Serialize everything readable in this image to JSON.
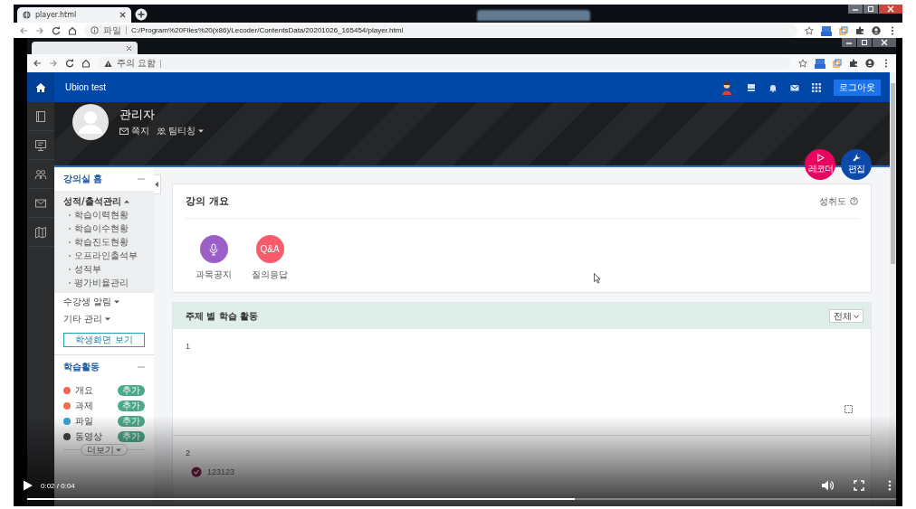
{
  "outer_browser": {
    "tab": {
      "title": "player.html"
    },
    "address": {
      "scheme_label": "파일",
      "url": "C:/Program%20Files%20(x86)/Lecoder/ContentsData/20201026_165454/player.html"
    }
  },
  "inner_browser": {
    "address": {
      "security_label": "주의 요함"
    }
  },
  "site": {
    "name": "Ubion test",
    "logout": "로그아웃"
  },
  "profile": {
    "name": "관리자",
    "links": [
      {
        "label": "쪽지",
        "kind": "mail"
      },
      {
        "label": "팀티칭",
        "kind": "team"
      }
    ]
  },
  "fabs": [
    {
      "label": "레코더",
      "kind": "play",
      "color": "#e8055f"
    },
    {
      "label": "편집",
      "kind": "wrench",
      "color": "#0b4aa8"
    }
  ],
  "course_menu": {
    "title": "강의실 홈",
    "groups": [
      {
        "label": "성적/출석관리",
        "expanded": true,
        "children": [
          "학습이력현황",
          "학습이수현황",
          "학습진도현황",
          "오프라인출석부",
          "성적부",
          "평가비율관리"
        ]
      },
      {
        "label": "수강생 알림",
        "expanded": false
      },
      {
        "label": "기타 관리",
        "expanded": false
      }
    ],
    "button": "학생화면 보기"
  },
  "activities": {
    "title": "학습활동",
    "items": [
      {
        "label": "개요",
        "color": "#f0645a",
        "action": "추가"
      },
      {
        "label": "과제",
        "color": "#f2704e",
        "action": "추가"
      },
      {
        "label": "파일",
        "color": "#3aa0d8",
        "action": "추가"
      },
      {
        "label": "동영상",
        "color": "#444444",
        "action": "추가"
      }
    ],
    "more": "더보기"
  },
  "overview": {
    "title": "강의 개요",
    "achievement": "성취도",
    "items": [
      {
        "label": "과목공지",
        "kind": "mic",
        "color": "#9c5fc7"
      },
      {
        "label": "질의응답",
        "kind": "text",
        "icon_text": "Q&A",
        "color": "#f75b6c"
      }
    ]
  },
  "weekly": {
    "title": "주제 별 학습 활동",
    "filter": "전체",
    "sections": [
      {
        "number": "1"
      },
      {
        "number": "2",
        "activities": [
          {
            "label": "123123"
          }
        ]
      }
    ]
  },
  "player": {
    "time": "0:02 / 0:04",
    "level": 0.63
  }
}
